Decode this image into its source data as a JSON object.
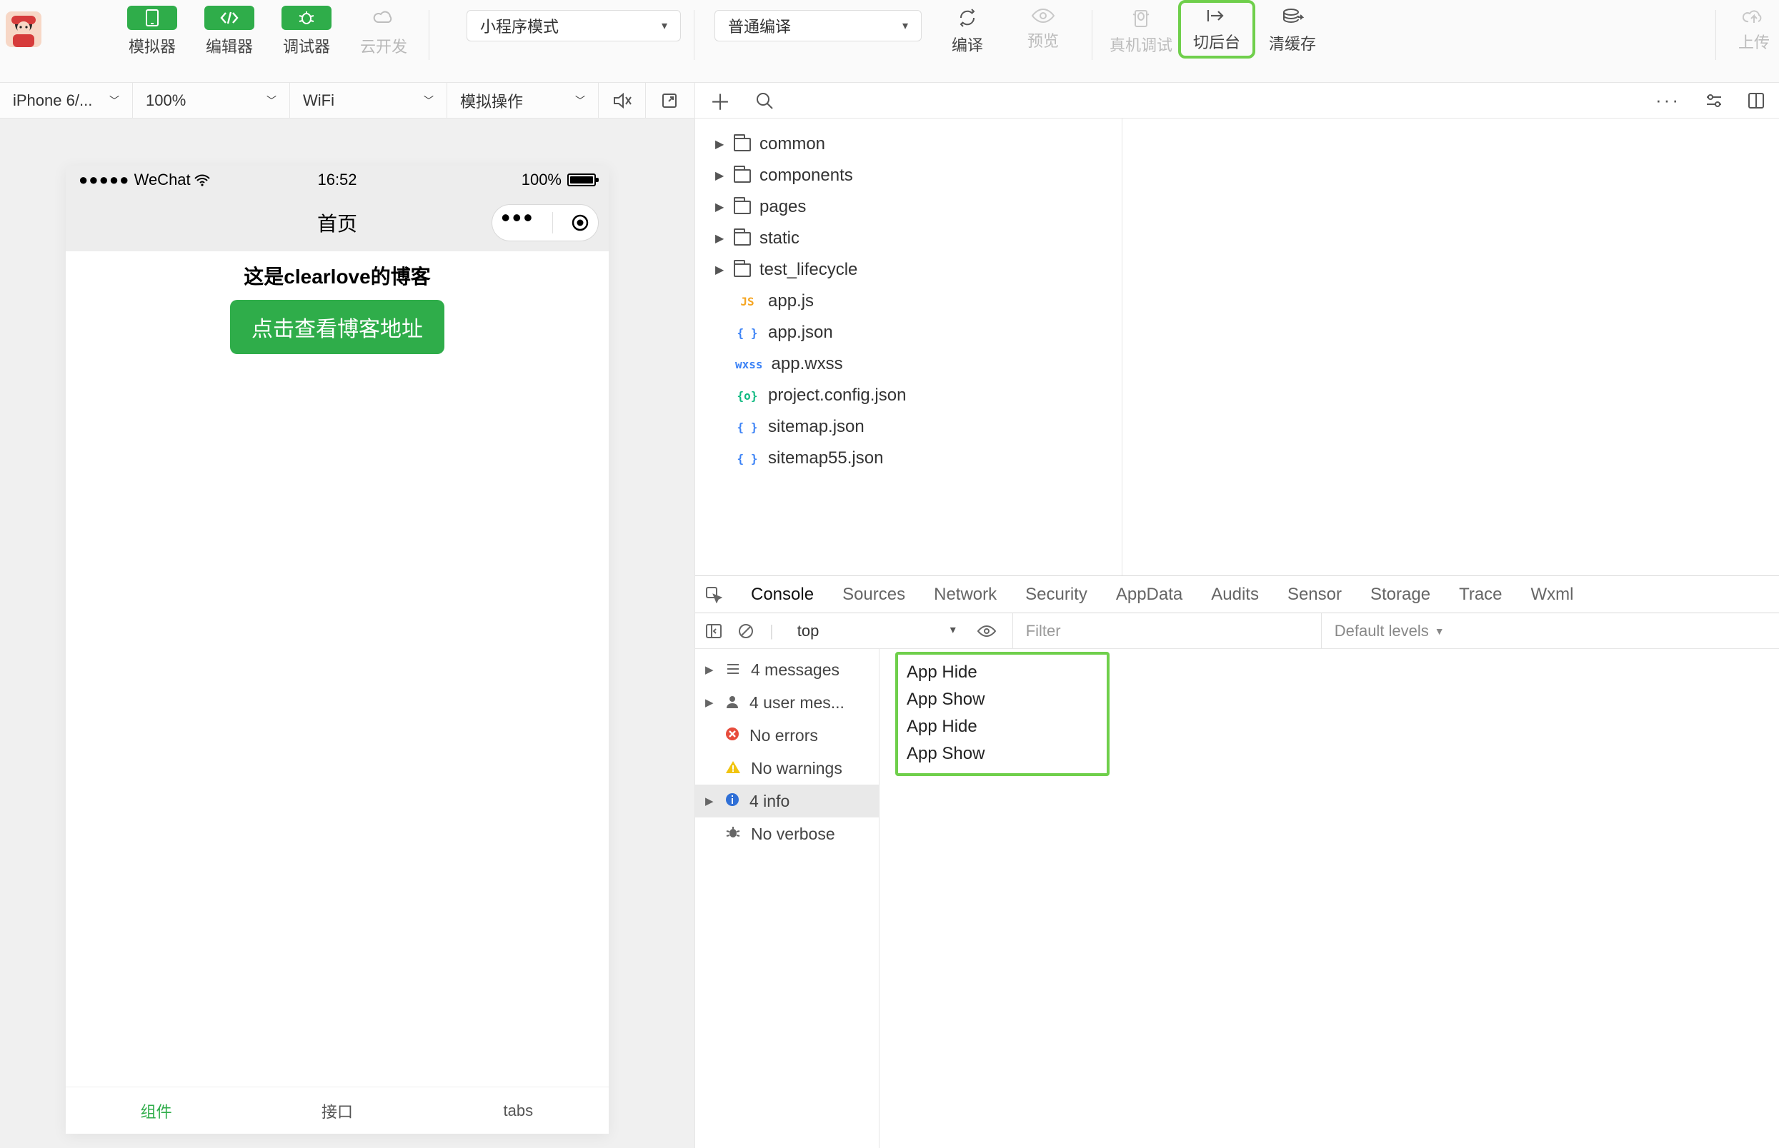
{
  "toolbar": {
    "simulator": "模拟器",
    "editor": "编辑器",
    "debugger": "调试器",
    "cloud": "云开发",
    "modeCombo": "小程序模式",
    "compileCombo": "普通编译",
    "compile": "编译",
    "preview": "预览",
    "remote": "真机调试",
    "background": "切后台",
    "clearCache": "清缓存",
    "upload": "上传"
  },
  "simbar": {
    "device": "iPhone 6/...",
    "zoom": "100%",
    "network": "WiFi",
    "simop": "模拟操作"
  },
  "phone": {
    "carrier": "WeChat",
    "time": "16:52",
    "battery": "100%",
    "navTitle": "首页",
    "heading": "这是clearlove的博客",
    "button": "点击查看博客地址",
    "tabs": [
      "组件",
      "接口",
      "tabs"
    ]
  },
  "tree": {
    "folders": [
      "common",
      "components",
      "pages",
      "static",
      "test_lifecycle"
    ],
    "files": [
      {
        "t": "JS",
        "cls": "ft-js",
        "n": "app.js"
      },
      {
        "t": "{ }",
        "cls": "ft-json",
        "n": "app.json"
      },
      {
        "t": "wxss",
        "cls": "ft-wxss",
        "n": "app.wxss"
      },
      {
        "t": "{o}",
        "cls": "ft-cfg",
        "n": "project.config.json"
      },
      {
        "t": "{ }",
        "cls": "ft-json",
        "n": "sitemap.json"
      },
      {
        "t": "{ }",
        "cls": "ft-json",
        "n": "sitemap55.json"
      }
    ]
  },
  "devtools": {
    "tabs": [
      "Console",
      "Sources",
      "Network",
      "Security",
      "AppData",
      "Audits",
      "Sensor",
      "Storage",
      "Trace",
      "Wxml"
    ],
    "context": "top",
    "filter": "Filter",
    "levels": "Default levels",
    "side": [
      {
        "tri": "▶",
        "icon": "list",
        "label": "4 messages"
      },
      {
        "tri": "▶",
        "icon": "user",
        "label": "4 user mes..."
      },
      {
        "tri": "",
        "icon": "err",
        "label": "No errors"
      },
      {
        "tri": "",
        "icon": "warn",
        "label": "No warnings"
      },
      {
        "tri": "▶",
        "icon": "info",
        "label": "4 info",
        "sel": true
      },
      {
        "tri": "",
        "icon": "bug",
        "label": "No verbose"
      }
    ],
    "log": [
      "App Hide",
      "App Show",
      "App Hide",
      "App Show"
    ]
  },
  "watermark": ""
}
